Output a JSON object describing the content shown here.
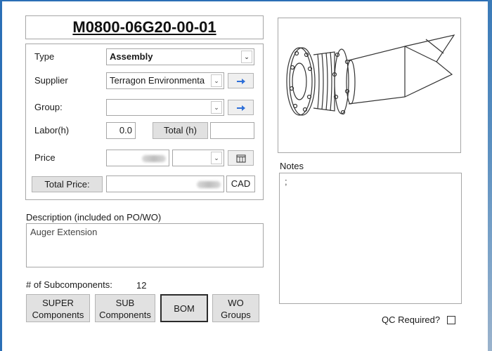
{
  "part_number": "M0800-06G20-00-01",
  "form": {
    "type_label": "Type",
    "type_value": "Assembly",
    "supplier_label": "Supplier",
    "supplier_value": "Terragon Environmenta",
    "group_label": "Group:",
    "group_value": "",
    "labor_label": "Labor(h)",
    "labor_value": "0.0",
    "total_h_label": "Total (h)",
    "total_h_value": "",
    "price_label": "Price",
    "price_currency_value": "",
    "total_price_label": "Total Price:",
    "total_price_currency": "CAD"
  },
  "description": {
    "label": "Description (included on PO/WO)",
    "value": "Auger Extension"
  },
  "subcomponents": {
    "label": "# of Subcomponents:",
    "count": "12"
  },
  "buttons": {
    "super_line1": "SUPER",
    "super_line2": "Components",
    "sub_line1": "SUB",
    "sub_line2": "Components",
    "bom": "BOM",
    "wo_line1": "WO",
    "wo_line2": "Groups"
  },
  "notes": {
    "label": "Notes",
    "value": ";"
  },
  "qc": {
    "label": "QC Required?",
    "checked": false
  },
  "icons": {
    "combo": "chevron-down-icon",
    "goto": "arrow-right-icon",
    "calendar": "calendar-icon"
  },
  "colors": {
    "window_border": "#2b6fb6",
    "goto_arrow": "#2e6fd8"
  }
}
